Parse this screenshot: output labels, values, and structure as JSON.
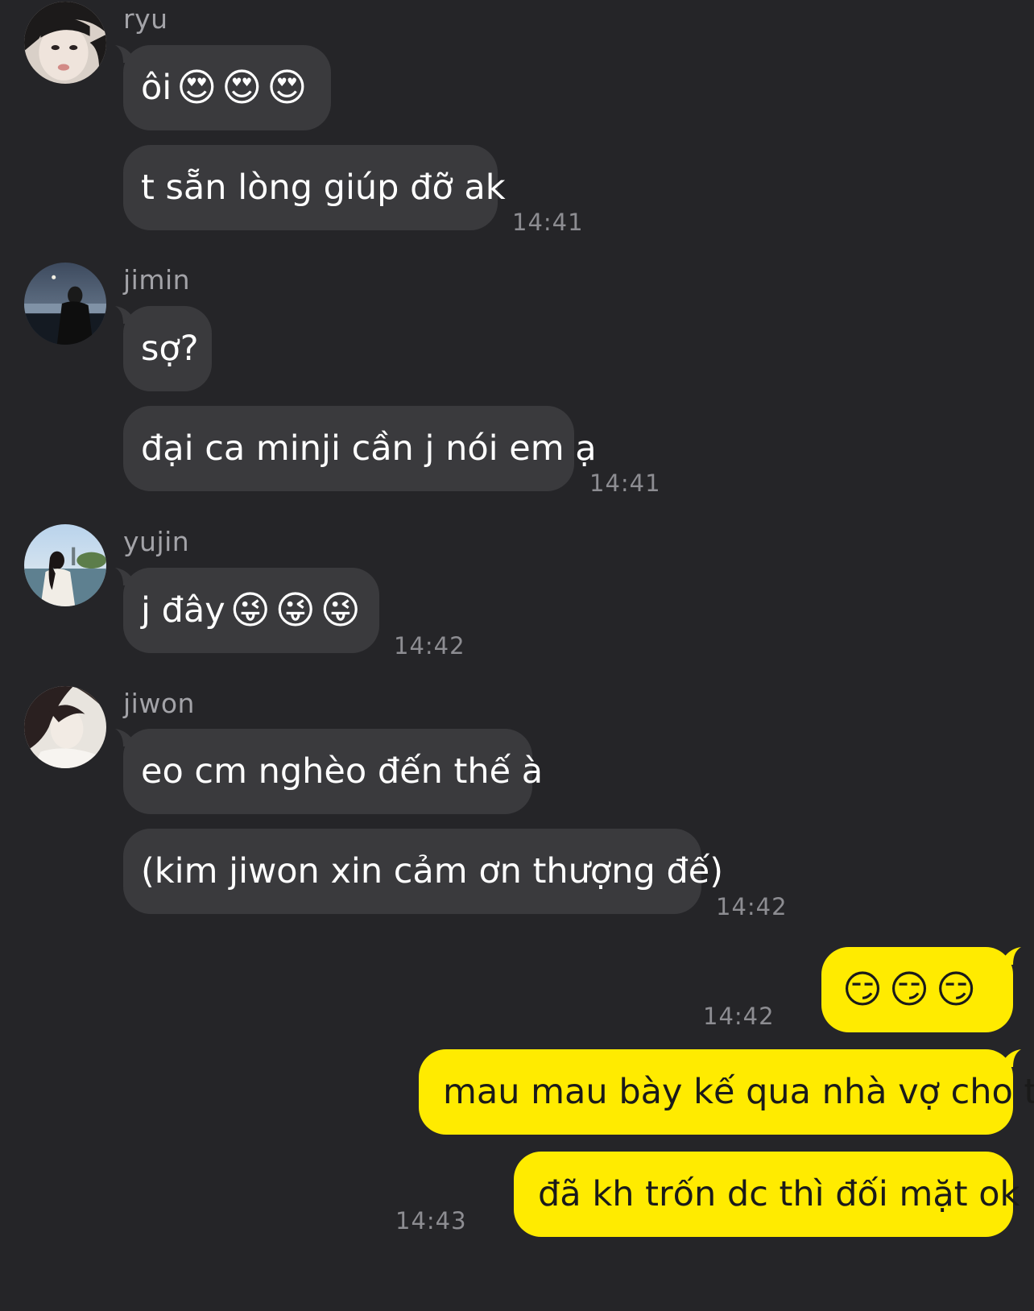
{
  "colors": {
    "background": "#252528",
    "incoming_bubble": "#3a3a3d",
    "outgoing_bubble": "#ffeb00",
    "sender_text": "#a3a3a8",
    "time_text": "#8d8d92"
  },
  "groups": [
    {
      "sender": "ryu",
      "avatar": "ryu-avatar",
      "messages": [
        {
          "text": "ôi",
          "emoji": "😍😍😍"
        },
        {
          "text": "t sẵn lòng giúp đỡ ak"
        }
      ],
      "time": "14:41"
    },
    {
      "sender": "jimin",
      "avatar": "jimin-avatar",
      "messages": [
        {
          "text": "sợ?"
        },
        {
          "text": "đại ca minji cần j nói em ạ"
        }
      ],
      "time": "14:41"
    },
    {
      "sender": "yujin",
      "avatar": "yujin-avatar",
      "messages": [
        {
          "text": "j đây",
          "emoji": "😜😜😜"
        }
      ],
      "time": "14:42"
    },
    {
      "sender": "jiwon",
      "avatar": "jiwon-avatar",
      "messages": [
        {
          "text": "eo cm nghèo đến thế à"
        },
        {
          "text": "(kim jiwon xin cảm ơn thượng đế)"
        }
      ],
      "time": "14:42"
    }
  ],
  "outgoing": [
    {
      "emoji": "😏😏😏",
      "time": "14:42"
    },
    {
      "text": "mau mau bày kế qua nhà vợ cho t"
    },
    {
      "text": "đã kh trốn dc thì đối mặt ok",
      "time": "14:43"
    }
  ]
}
